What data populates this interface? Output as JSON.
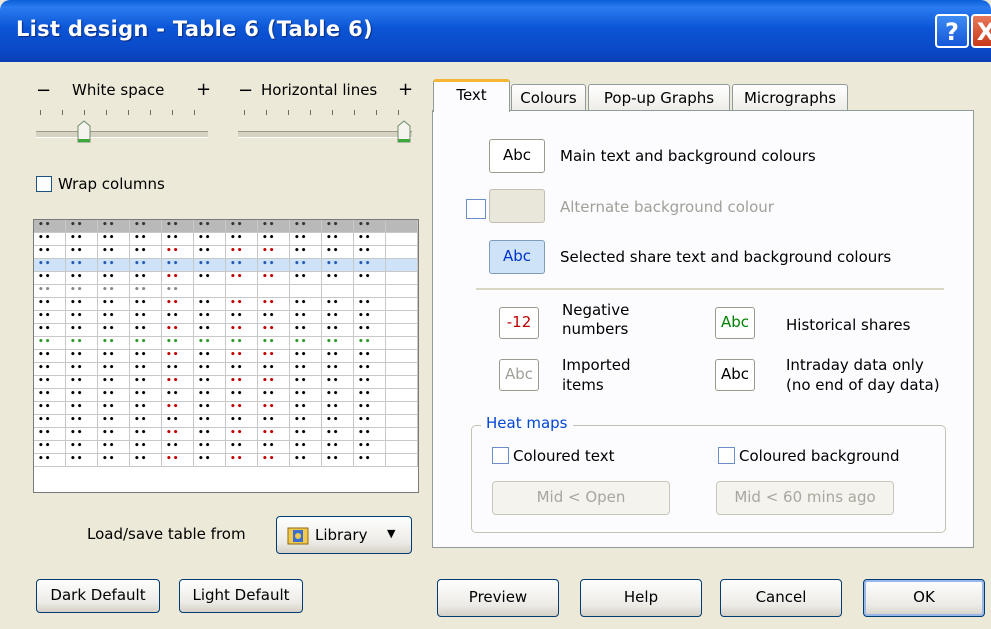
{
  "window": {
    "title": "List design - Table 6 (Table 6)",
    "help_glyph": "?",
    "close_glyph": "X"
  },
  "sliders": {
    "white_space": {
      "minus": "−",
      "label": "White space",
      "plus": "+",
      "level": 0.25
    },
    "horizontal_lines": {
      "minus": "−",
      "label": "Horizontal lines",
      "plus": "+",
      "level": 1.0
    }
  },
  "wrap_columns": {
    "label": "Wrap columns",
    "checked": false
  },
  "preview_grid": {
    "cell_glyph": "••"
  },
  "load_save": {
    "label": "Load/save table from",
    "button": "Library",
    "icon": "library-book-icon",
    "arrow": "▼"
  },
  "tabs": [
    "Text",
    "Colours",
    "Pop-up Graphs",
    "Micrographs"
  ],
  "text_tab": {
    "main": {
      "swatch": "Abc",
      "label": "Main text and background colours"
    },
    "alternate": {
      "label": "Alternate background colour",
      "checked": false
    },
    "selected": {
      "swatch": "Abc",
      "label": "Selected share text and background colours"
    },
    "negative": {
      "swatch": "-12",
      "label_line1": "Negative",
      "label_line2": "numbers"
    },
    "historical": {
      "swatch": "Abc",
      "label": "Historical shares"
    },
    "imported": {
      "swatch": "Abc",
      "label_line1": "Imported",
      "label_line2": "items"
    },
    "intraday": {
      "swatch": "Abc",
      "label_line1": "Intraday data only",
      "label_line2": "(no end of day data)"
    },
    "heat_maps": {
      "title": "Heat maps",
      "coloured_text": {
        "label": "Coloured text",
        "checked": false,
        "button": "Mid < Open"
      },
      "coloured_background": {
        "label": "Coloured background",
        "checked": false,
        "button": "Mid < 60 mins ago"
      }
    }
  },
  "buttons": {
    "dark_default": "Dark Default",
    "light_default": "Light Default",
    "preview": "Preview",
    "help": "Help",
    "cancel": "Cancel",
    "ok": "OK"
  },
  "colors": {
    "title_blue": "#0a55d6",
    "selected_row": "#cfe3f8",
    "negative_red": "#c00000",
    "historical_green": "#008000",
    "heat_title_blue": "#0046d5"
  }
}
